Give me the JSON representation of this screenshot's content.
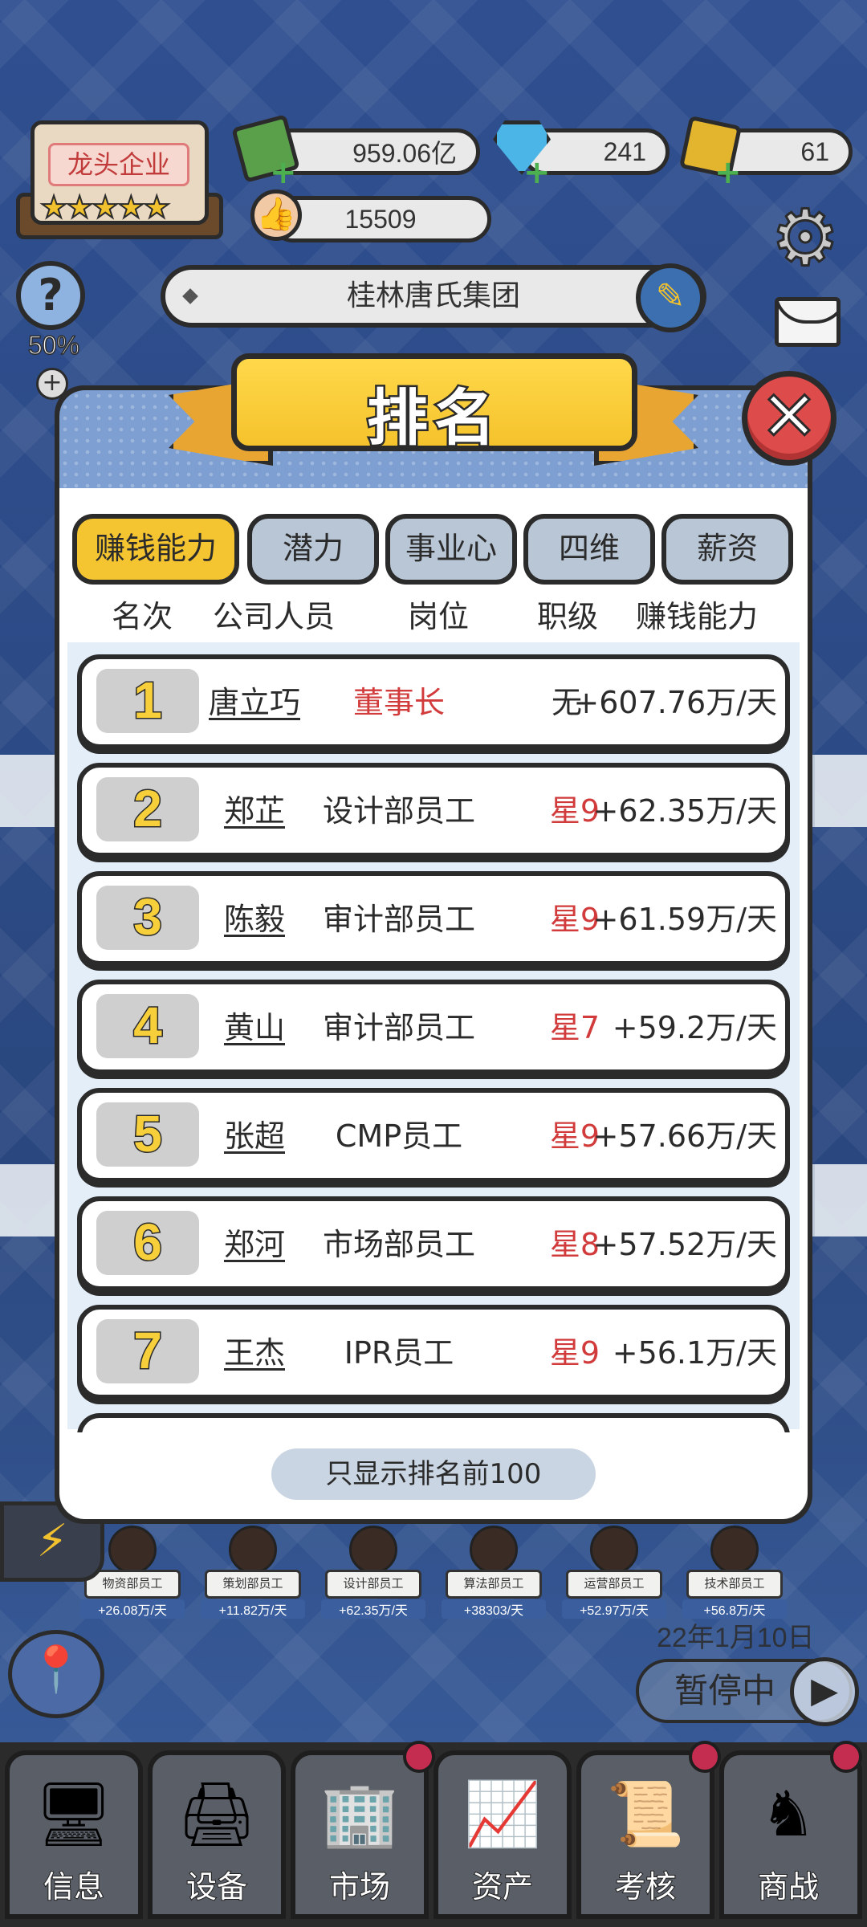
{
  "hud": {
    "cash": "959.06亿",
    "gems": "241",
    "gold": "61",
    "likes": "15509",
    "company_level_label": "龙头企业",
    "company_stars": "★★★★★",
    "company_name": "桂林唐氏集团",
    "help_percent": "50%"
  },
  "modal": {
    "title": "排名",
    "tabs": [
      {
        "label": "赚钱能力",
        "active": true
      },
      {
        "label": "潜力",
        "active": false
      },
      {
        "label": "事业心",
        "active": false
      },
      {
        "label": "四维",
        "active": false
      },
      {
        "label": "薪资",
        "active": false
      }
    ],
    "columns": [
      "名次",
      "公司人员",
      "岗位",
      "职级",
      "赚钱能力"
    ],
    "rows": [
      {
        "rank": "1",
        "name": "唐立巧",
        "position": "董事长",
        "level": "无",
        "earning": "+607.76万/天"
      },
      {
        "rank": "2",
        "name": "郑芷",
        "position": "设计部员工",
        "level": "星9",
        "earning": "+62.35万/天"
      },
      {
        "rank": "3",
        "name": "陈毅",
        "position": "审计部员工",
        "level": "星9",
        "earning": "+61.59万/天"
      },
      {
        "rank": "4",
        "name": "黄山",
        "position": "审计部员工",
        "level": "星7",
        "earning": "+59.2万/天"
      },
      {
        "rank": "5",
        "name": "张超",
        "position": "CMP员工",
        "level": "星9",
        "earning": "+57.66万/天"
      },
      {
        "rank": "6",
        "name": "郑河",
        "position": "市场部员工",
        "level": "星8",
        "earning": "+57.52万/天"
      },
      {
        "rank": "7",
        "name": "王杰",
        "position": "IPR员工",
        "level": "星9",
        "earning": "+56.1万/天"
      }
    ],
    "footer_note": "只显示排名前100"
  },
  "scene": {
    "date": "22年1月10日",
    "pause_label": "暂停中",
    "desk_labels": [
      "物资部员工",
      "策划部员工",
      "设计部员工",
      "算法部员工",
      "运营部员工",
      "技术部员工"
    ],
    "desk_earnings": [
      "+26.08万/天",
      "+11.82万/天",
      "+62.35万/天",
      "+38303/天",
      "+52.97万/天",
      "+56.8万/天"
    ]
  },
  "nav": [
    {
      "label": "信息",
      "icon": "monitor-icon",
      "badge": false
    },
    {
      "label": "设备",
      "icon": "printer-icon",
      "badge": false
    },
    {
      "label": "市场",
      "icon": "buildings-icon",
      "badge": true
    },
    {
      "label": "资产",
      "icon": "chart-growth-icon",
      "badge": false
    },
    {
      "label": "考核",
      "icon": "document-icon",
      "badge": true
    },
    {
      "label": "商战",
      "icon": "chess-icon",
      "badge": true
    }
  ],
  "colors": {
    "accent_yellow": "#f4c431",
    "close_red": "#de4b4b",
    "level_red": "#d23b3b",
    "tab_inactive": "#b9c6d6",
    "list_bg": "#e3eef8"
  }
}
